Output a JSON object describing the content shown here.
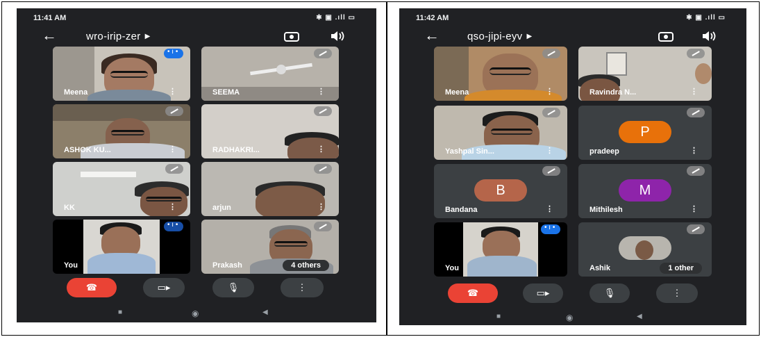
{
  "screens": [
    {
      "status_time": "11:41 AM",
      "meeting_code": "wro-irip-zer",
      "tiles": [
        {
          "name": "Meena",
          "state": "speaking"
        },
        {
          "name": "SEEMA",
          "state": "muted"
        },
        {
          "name": "ASHOK KU...",
          "state": "muted"
        },
        {
          "name": "RADHAKRI...",
          "state": "muted"
        },
        {
          "name": "KK",
          "state": "muted"
        },
        {
          "name": "arjun",
          "state": "muted"
        },
        {
          "name": "You",
          "state": "speaking"
        },
        {
          "name": "Prakash",
          "state": "muted",
          "others": "4 others"
        }
      ]
    },
    {
      "status_time": "11:42 AM",
      "meeting_code": "qso-jipi-eyv",
      "tiles": [
        {
          "name": "Meena",
          "state": "muted"
        },
        {
          "name": "Ravindra N...",
          "state": "muted"
        },
        {
          "name": "Yashpal Sin...",
          "state": "muted"
        },
        {
          "name": "pradeep",
          "state": "muted",
          "avatar_letter": "P",
          "avatar_color": "#e8710a"
        },
        {
          "name": "Bandana",
          "state": "muted",
          "avatar_letter": "B",
          "avatar_color": "#b5654a"
        },
        {
          "name": "Mithilesh",
          "state": "muted",
          "avatar_letter": "M",
          "avatar_color": "#8e24aa"
        },
        {
          "name": "You",
          "state": "speaking"
        },
        {
          "name": "Ashik",
          "state": "muted",
          "others": "1 other"
        }
      ]
    }
  ],
  "colors": {
    "background": "#202124",
    "tile": "#3c4043",
    "end_call": "#ea4335",
    "speaking": "#1a73e8"
  },
  "icons": {
    "back": "arrow-left-icon",
    "switch_camera": "switch-camera-icon",
    "audio_output": "speaker-icon",
    "end_call": "phone-hangup-icon",
    "camera": "video-camera-icon",
    "mic": "microphone-icon",
    "more": "more-vert-icon",
    "muted": "mic-off-icon"
  }
}
